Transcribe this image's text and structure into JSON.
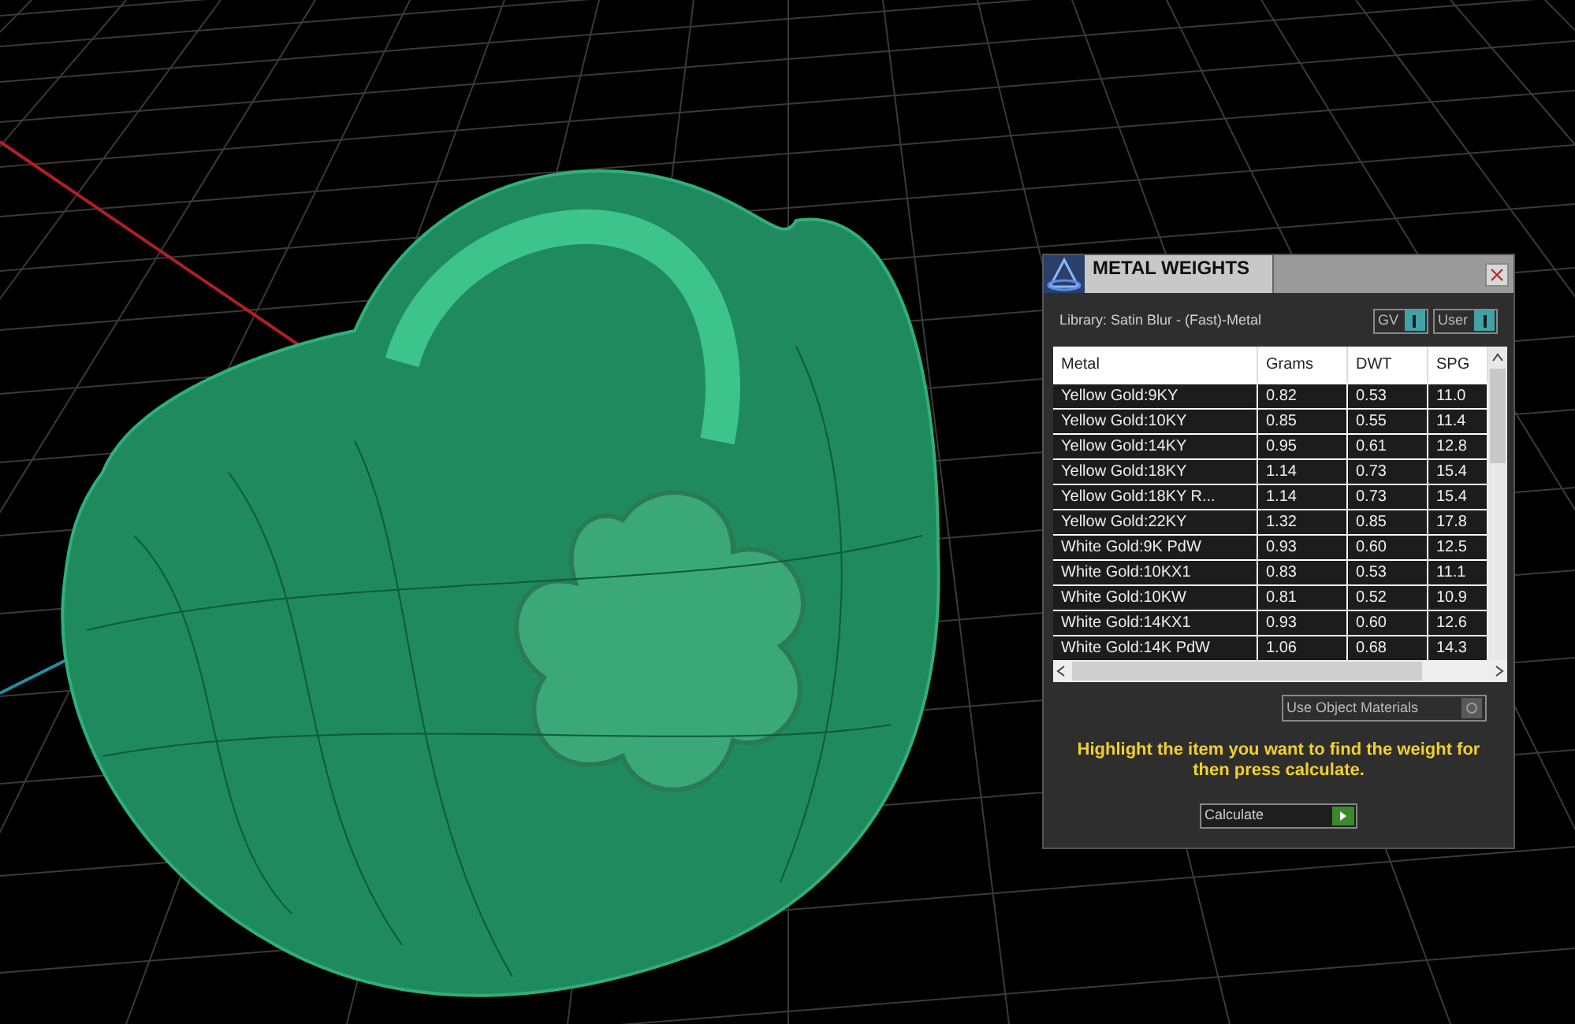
{
  "dialog": {
    "title": "METAL WEIGHTS",
    "library": "Library: Satin Blur - (Fast)-Metal",
    "toggles": [
      {
        "label": "GV",
        "on": true
      },
      {
        "label": "User",
        "on": true
      }
    ],
    "table": {
      "columns": [
        "Metal",
        "Grams",
        "DWT",
        "SPG"
      ],
      "rows": [
        [
          "Yellow Gold:9KY",
          "0.82",
          "0.53",
          "11.0"
        ],
        [
          "Yellow Gold:10KY",
          "0.85",
          "0.55",
          "11.4"
        ],
        [
          "Yellow Gold:14KY",
          "0.95",
          "0.61",
          "12.8"
        ],
        [
          "Yellow Gold:18KY",
          "1.14",
          "0.73",
          "15.4"
        ],
        [
          "Yellow Gold:18KY R...",
          "1.14",
          "0.73",
          "15.4"
        ],
        [
          "Yellow Gold:22KY",
          "1.32",
          "0.85",
          "17.8"
        ],
        [
          "White Gold:9K PdW",
          "0.93",
          "0.60",
          "12.5"
        ],
        [
          "White Gold:10KX1",
          "0.83",
          "0.53",
          "11.1"
        ],
        [
          "White Gold:10KW",
          "0.81",
          "0.52",
          "10.9"
        ],
        [
          "White Gold:14KX1",
          "0.93",
          "0.60",
          "12.6"
        ],
        [
          "White Gold:14K PdW",
          "1.06",
          "0.68",
          "14.3"
        ]
      ]
    },
    "use_object_materials": {
      "label": "Use Object Materials",
      "on": false
    },
    "instruction": "Highlight the item you want to find the weight for then press calculate.",
    "calculate_button": "Calculate"
  }
}
